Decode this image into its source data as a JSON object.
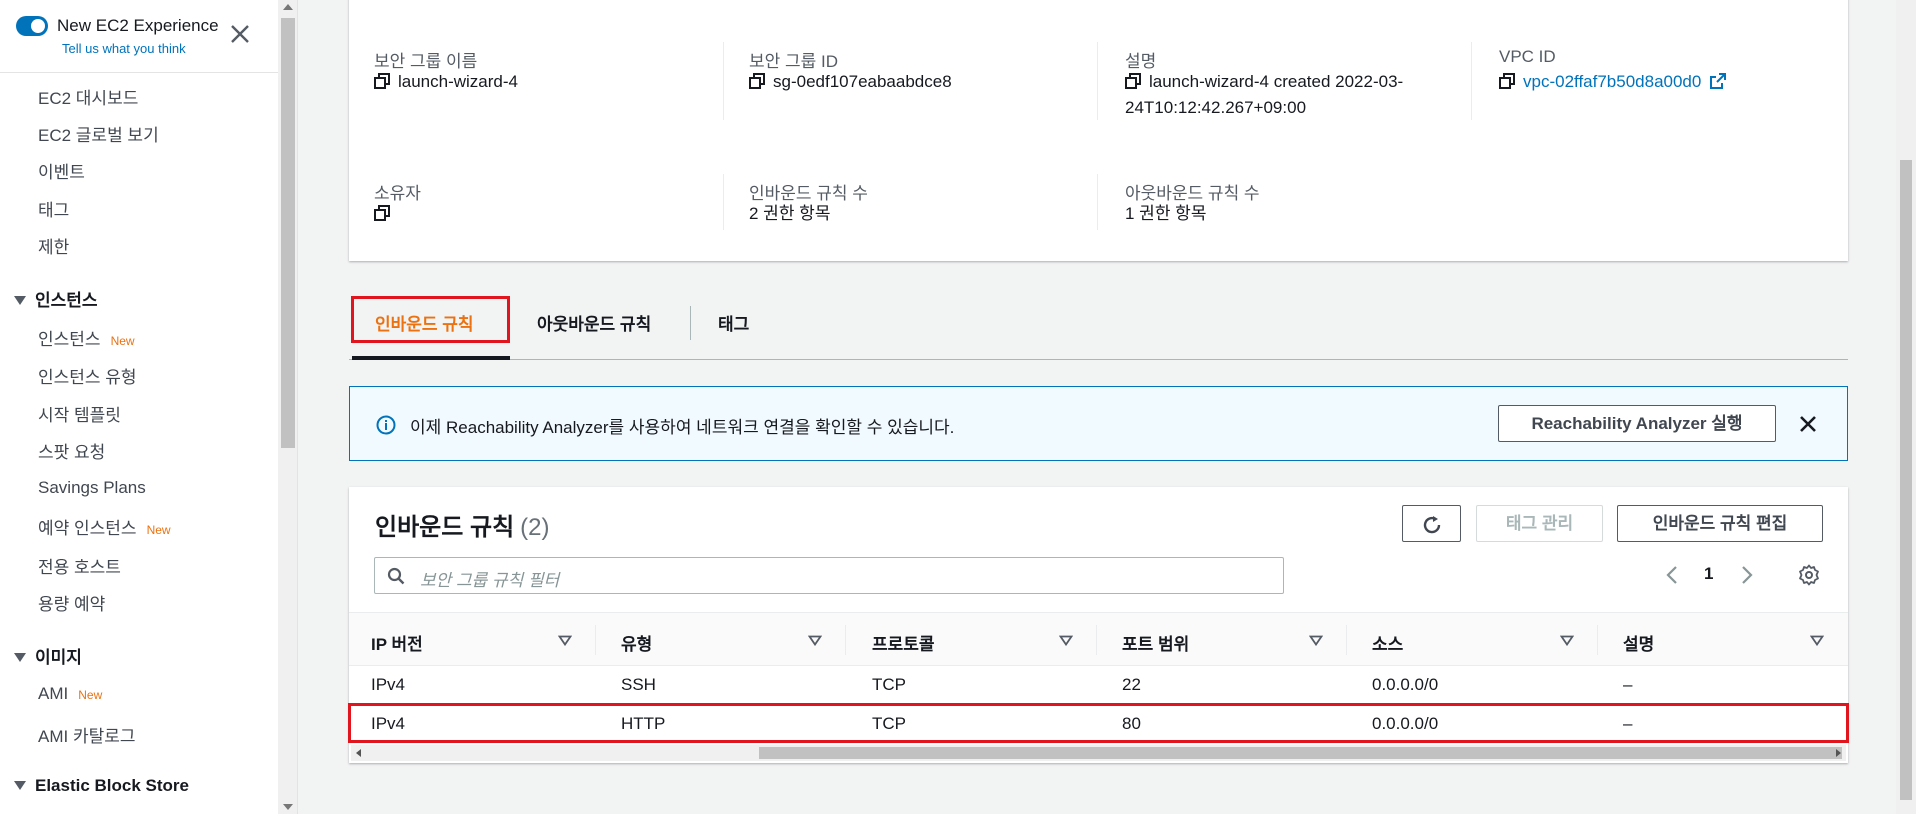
{
  "sidebar": {
    "experience_title": "New EC2 Experience",
    "experience_link": "Tell us what you think",
    "items_top": [
      "EC2 대시보드",
      "EC2 글로벌 보기",
      "이벤트",
      "태그",
      "제한"
    ],
    "section_instances": "인스턴스",
    "instances_items": [
      {
        "label": "인스턴스",
        "badge": "New"
      },
      {
        "label": "인스턴스 유형",
        "badge": ""
      },
      {
        "label": "시작 템플릿",
        "badge": ""
      },
      {
        "label": "스팟 요청",
        "badge": ""
      },
      {
        "label": "Savings Plans",
        "badge": ""
      },
      {
        "label": "예약 인스턴스",
        "badge": "New"
      },
      {
        "label": "전용 호스트",
        "badge": ""
      },
      {
        "label": "용량 예약",
        "badge": ""
      }
    ],
    "section_images": "이미지",
    "images_items": [
      {
        "label": "AMI",
        "badge": "New"
      },
      {
        "label": "AMI 카탈로그",
        "badge": ""
      }
    ],
    "section_ebs": "Elastic Block Store"
  },
  "details": {
    "sg_name_label": "보안 그룹 이름",
    "sg_name": "launch-wizard-4",
    "sg_id_label": "보안 그룹 ID",
    "sg_id": "sg-0edf107eabaabdce8",
    "desc_label": "설명",
    "desc_line1": "launch-wizard-4 created 2022-03-",
    "desc_line2": "24T10:12:42.267+09:00",
    "vpc_label": "VPC ID",
    "vpc_id": "vpc-02ffaf7b50d8a00d0",
    "owner_label": "소유자",
    "owner": "",
    "inbound_count_label": "인바운드 규칙 수",
    "inbound_count": "2 권한 항목",
    "outbound_count_label": "아웃바운드 규칙 수",
    "outbound_count": "1 권한 항목"
  },
  "tabs": [
    "인바운드 규칙",
    "아웃바운드 규칙",
    "태그"
  ],
  "banner": {
    "message": "이제 Reachability Analyzer를 사용하여 네트워크 연결을 확인할 수 있습니다.",
    "button": "Reachability Analyzer 실행"
  },
  "rules": {
    "title": "인바운드 규칙",
    "count": "(2)",
    "manage_tags": "태그 관리",
    "edit_rules": "인바운드 규칙 편집",
    "search_placeholder": "보안 그룹 규칙 필터",
    "page": "1",
    "columns": [
      "IP 버전",
      "유형",
      "프로토콜",
      "포트 범위",
      "소스",
      "설명"
    ],
    "rows": [
      [
        "IPv4",
        "SSH",
        "TCP",
        "22",
        "0.0.0.0/0",
        "–"
      ],
      [
        "IPv4",
        "HTTP",
        "TCP",
        "80",
        "0.0.0.0/0",
        "–"
      ]
    ]
  },
  "colors": {
    "accent_orange": "#ec7211",
    "link_blue": "#0073bb",
    "highlight_red": "#e0151e"
  }
}
